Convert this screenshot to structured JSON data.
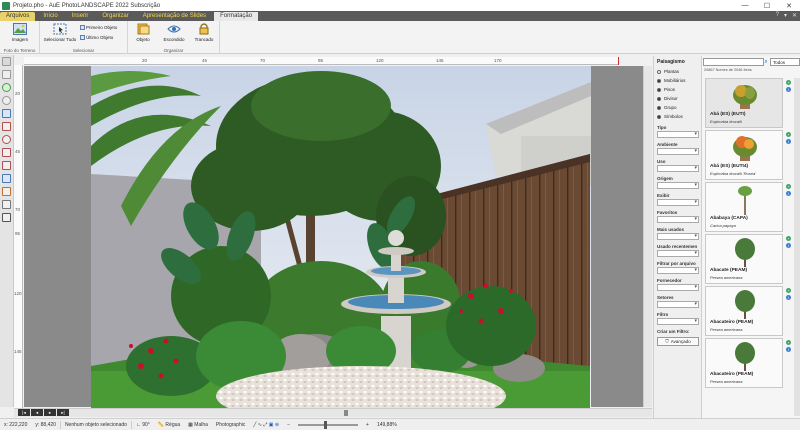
{
  "window": {
    "title": "Projeto.pho - AuE PhotoLANDSCAPE 2022 Subscrição",
    "controls": [
      "—",
      "☐",
      "✕"
    ]
  },
  "ribbon": {
    "tabs": [
      {
        "label": "Arquivos",
        "state": "active"
      },
      {
        "label": "Início",
        "state": ""
      },
      {
        "label": "Inserir",
        "state": ""
      },
      {
        "label": "Organizar",
        "state": ""
      },
      {
        "label": "Apresentação de Slides",
        "state": ""
      },
      {
        "label": "Formatação",
        "state": "context"
      }
    ],
    "right_controls": [
      "?",
      "▾",
      "✕"
    ],
    "groups": {
      "photo": {
        "label": "Foto do Terreno",
        "image_button": "Imagem"
      },
      "select": {
        "label": "Selecionar",
        "select_all": "Selecionar Tudo",
        "first_object": "Primeiro Objeto",
        "last_object": "Último Objeto"
      },
      "organize": {
        "label": "Organizar",
        "object": "Objeto",
        "hidden": "Escondido",
        "locked": "Trancado"
      }
    }
  },
  "rulers": {
    "horizontal": [
      "20",
      "45",
      "70",
      "95",
      "120",
      "145",
      "170"
    ],
    "vertical": [
      "20",
      "45",
      "70",
      "95",
      "120",
      "145"
    ]
  },
  "library": {
    "search_placeholder": "",
    "scope_select": "Todos",
    "count_text": "20867 Nomes de 2046 Itens",
    "items": [
      {
        "name": "Abá (ES) (EUTI)",
        "sci": "Euphorbia tirucalli"
      },
      {
        "name": "Abá (ES) (EUTI4)",
        "sci": "Euphorbia tirucalli 'Rosea'"
      },
      {
        "name": "Ababaya (CAPA)",
        "sci": "Carica papaya"
      },
      {
        "name": "Abacate (PEAM)",
        "sci": "Persea americana"
      },
      {
        "name": "Abacateiro (PEAM)",
        "sci": "Persea americana"
      },
      {
        "name": "Abacateiro (PEAM)",
        "sci": "Persea americana"
      }
    ]
  },
  "filters": {
    "title": "Paisagismo",
    "options": [
      {
        "label": "Plantas",
        "checked": false
      },
      {
        "label": "Mobiliários",
        "checked": true
      },
      {
        "label": "Pisos",
        "checked": true
      },
      {
        "label": "Divisor",
        "checked": true
      },
      {
        "label": "Grupo",
        "checked": true
      },
      {
        "label": "Símbolos",
        "checked": true
      }
    ],
    "categories": [
      "Tipo",
      "Ambiente",
      "Uso",
      "Origem",
      "Exibir",
      "Favoritos",
      "Mais usados",
      "Usado recentemen",
      "Filtrar por arquivo",
      "Fornecedor",
      "Setores",
      "Filtro",
      "Criar um Filtro:"
    ],
    "advanced_button": "Avançado"
  },
  "status": {
    "coord_x": "x: 222,220",
    "coord_y": "y: 88,420",
    "selection": "Nenhum objeto selecionado",
    "angle": "90°",
    "ruler": "Régua",
    "grid": "Malha",
    "mode": "Photographic",
    "zoom": "149,88%"
  },
  "colors": {
    "ribbon_tabs_bg": "#5a5a5a",
    "tab_text": "#f5d84a",
    "add_icon": "#3aa56a",
    "info_icon": "#3a7fd0"
  }
}
